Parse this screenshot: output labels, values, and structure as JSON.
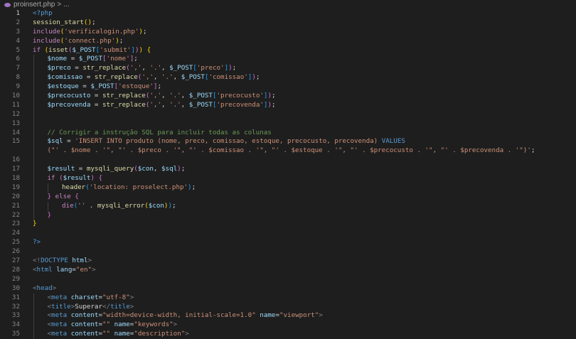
{
  "breadcrumb": {
    "file": "proinsert.php",
    "separator": ">",
    "more": "..."
  },
  "lines": [
    {
      "n": "1",
      "active": true,
      "indent": 0,
      "tokens": [
        [
          "tag",
          "<?php"
        ]
      ]
    },
    {
      "n": "2",
      "indent": 0,
      "tokens": [
        [
          "fn",
          "session_start"
        ],
        [
          "br1",
          "()"
        ],
        [
          "pl",
          ";"
        ]
      ]
    },
    {
      "n": "3",
      "indent": 0,
      "tokens": [
        [
          "kw",
          "include"
        ],
        [
          "br1",
          "("
        ],
        [
          "str",
          "'verificalogin.php'"
        ],
        [
          "br1",
          ")"
        ],
        [
          "pl",
          ";"
        ]
      ]
    },
    {
      "n": "4",
      "indent": 0,
      "tokens": [
        [
          "kw",
          "include"
        ],
        [
          "br1",
          "("
        ],
        [
          "str",
          "'connect.php'"
        ],
        [
          "br1",
          ")"
        ],
        [
          "pl",
          ";"
        ]
      ]
    },
    {
      "n": "5",
      "indent": 0,
      "tokens": [
        [
          "kw",
          "if"
        ],
        [
          "pl",
          " "
        ],
        [
          "br1",
          "("
        ],
        [
          "fn",
          "isset"
        ],
        [
          "br2",
          "("
        ],
        [
          "var",
          "$_POST"
        ],
        [
          "br3",
          "["
        ],
        [
          "str",
          "'submit'"
        ],
        [
          "br3",
          "]"
        ],
        [
          "br2",
          ")"
        ],
        [
          "br1",
          ")"
        ],
        [
          "pl",
          " "
        ],
        [
          "br1",
          "{"
        ]
      ]
    },
    {
      "n": "6",
      "indent": 1,
      "tokens": [
        [
          "var",
          "$nome"
        ],
        [
          "pl",
          " = "
        ],
        [
          "var",
          "$_POST"
        ],
        [
          "br2",
          "["
        ],
        [
          "str",
          "'nome'"
        ],
        [
          "br2",
          "]"
        ],
        [
          "pl",
          ";"
        ]
      ]
    },
    {
      "n": "7",
      "indent": 1,
      "tokens": [
        [
          "var",
          "$preco"
        ],
        [
          "pl",
          " = "
        ],
        [
          "fn",
          "str_replace"
        ],
        [
          "br2",
          "("
        ],
        [
          "str",
          "','"
        ],
        [
          "pl",
          ", "
        ],
        [
          "str",
          "'.'"
        ],
        [
          "pl",
          ", "
        ],
        [
          "var",
          "$_POST"
        ],
        [
          "br3",
          "["
        ],
        [
          "str",
          "'preco'"
        ],
        [
          "br3",
          "]"
        ],
        [
          "br2",
          ")"
        ],
        [
          "pl",
          ";"
        ]
      ]
    },
    {
      "n": "8",
      "indent": 1,
      "tokens": [
        [
          "var",
          "$comissao"
        ],
        [
          "pl",
          " = "
        ],
        [
          "fn",
          "str_replace"
        ],
        [
          "br2",
          "("
        ],
        [
          "str",
          "','"
        ],
        [
          "pl",
          ", "
        ],
        [
          "str",
          "'.'"
        ],
        [
          "pl",
          ", "
        ],
        [
          "var",
          "$_POST"
        ],
        [
          "br3",
          "["
        ],
        [
          "str",
          "'comissao'"
        ],
        [
          "br3",
          "]"
        ],
        [
          "br2",
          ")"
        ],
        [
          "pl",
          ";"
        ]
      ]
    },
    {
      "n": "9",
      "indent": 1,
      "tokens": [
        [
          "var",
          "$estoque"
        ],
        [
          "pl",
          " = "
        ],
        [
          "var",
          "$_POST"
        ],
        [
          "br2",
          "["
        ],
        [
          "str",
          "'estoque'"
        ],
        [
          "br2",
          "]"
        ],
        [
          "pl",
          ";"
        ]
      ]
    },
    {
      "n": "10",
      "indent": 1,
      "tokens": [
        [
          "var",
          "$precocusto"
        ],
        [
          "pl",
          " = "
        ],
        [
          "fn",
          "str_replace"
        ],
        [
          "br2",
          "("
        ],
        [
          "str",
          "','"
        ],
        [
          "pl",
          ", "
        ],
        [
          "str",
          "'.'"
        ],
        [
          "pl",
          ", "
        ],
        [
          "var",
          "$_POST"
        ],
        [
          "br3",
          "["
        ],
        [
          "str",
          "'precocusto'"
        ],
        [
          "br3",
          "]"
        ],
        [
          "br2",
          ")"
        ],
        [
          "pl",
          ";"
        ]
      ]
    },
    {
      "n": "11",
      "indent": 1,
      "tokens": [
        [
          "var",
          "$precovenda"
        ],
        [
          "pl",
          " = "
        ],
        [
          "fn",
          "str_replace"
        ],
        [
          "br2",
          "("
        ],
        [
          "str",
          "','"
        ],
        [
          "pl",
          ", "
        ],
        [
          "str",
          "'.'"
        ],
        [
          "pl",
          ", "
        ],
        [
          "var",
          "$_POST"
        ],
        [
          "br3",
          "["
        ],
        [
          "str",
          "'precovenda'"
        ],
        [
          "br3",
          "]"
        ],
        [
          "br2",
          ")"
        ],
        [
          "pl",
          ";"
        ]
      ]
    },
    {
      "n": "12",
      "indent": 1,
      "tokens": []
    },
    {
      "n": "13",
      "indent": 1,
      "tokens": []
    },
    {
      "n": "14",
      "indent": 1,
      "tokens": [
        [
          "com",
          "// Corrigir a instrução SQL para incluir todas as colunas"
        ]
      ]
    },
    {
      "n": "15",
      "indent": 1,
      "tokens": [
        [
          "var",
          "$sql"
        ],
        [
          "pl",
          " = "
        ],
        [
          "str",
          "'INSERT INTO produto (nome, preco, comissao, estoque, precocusto, precovenda) "
        ],
        [
          "tag",
          "VALUES"
        ]
      ]
    },
    {
      "n": "",
      "indent": 1,
      "tokens": [
        [
          "str",
          "(\"' . $nome . '\", \"' . $preco . '\", \"' . $comissao . '\", \"' . $estoque . '\", \"' . $precocusto . '\", \"' . $precovenda . '\")'"
        ],
        [
          "pl",
          ";"
        ]
      ]
    },
    {
      "n": "16",
      "indent": 1,
      "tokens": []
    },
    {
      "n": "17",
      "indent": 1,
      "tokens": [
        [
          "var",
          "$result"
        ],
        [
          "pl",
          " = "
        ],
        [
          "fn",
          "mysqli_query"
        ],
        [
          "br2",
          "("
        ],
        [
          "var",
          "$con"
        ],
        [
          "pl",
          ", "
        ],
        [
          "var",
          "$sql"
        ],
        [
          "br2",
          ")"
        ],
        [
          "pl",
          ";"
        ]
      ]
    },
    {
      "n": "18",
      "indent": 1,
      "tokens": [
        [
          "kw",
          "if"
        ],
        [
          "pl",
          " "
        ],
        [
          "br2",
          "("
        ],
        [
          "var",
          "$result"
        ],
        [
          "br2",
          ")"
        ],
        [
          "pl",
          " "
        ],
        [
          "br2",
          "{"
        ]
      ]
    },
    {
      "n": "19",
      "indent": 2,
      "tokens": [
        [
          "fn",
          "header"
        ],
        [
          "br3",
          "("
        ],
        [
          "str",
          "'location: proselect.php'"
        ],
        [
          "br3",
          ")"
        ],
        [
          "pl",
          ";"
        ]
      ]
    },
    {
      "n": "20",
      "indent": 1,
      "tokens": [
        [
          "br2",
          "}"
        ],
        [
          "pl",
          " "
        ],
        [
          "kw",
          "else"
        ],
        [
          "pl",
          " "
        ],
        [
          "br2",
          "{"
        ]
      ]
    },
    {
      "n": "21",
      "indent": 2,
      "tokens": [
        [
          "kw",
          "die"
        ],
        [
          "br3",
          "("
        ],
        [
          "str",
          "''"
        ],
        [
          "pl",
          " . "
        ],
        [
          "fn",
          "mysqli_error"
        ],
        [
          "br1",
          "("
        ],
        [
          "var",
          "$con"
        ],
        [
          "br1",
          ")"
        ],
        [
          "br3",
          ")"
        ],
        [
          "pl",
          ";"
        ]
      ]
    },
    {
      "n": "22",
      "indent": 1,
      "tokens": [
        [
          "br2",
          "}"
        ]
      ]
    },
    {
      "n": "23",
      "indent": 0,
      "tokens": [
        [
          "br1",
          "}"
        ]
      ]
    },
    {
      "n": "24",
      "indent": 0,
      "tokens": []
    },
    {
      "n": "25",
      "indent": 0,
      "tokens": [
        [
          "tag",
          "?>"
        ]
      ]
    },
    {
      "n": "26",
      "indent": 0,
      "tokens": []
    },
    {
      "n": "27",
      "indent": 0,
      "tokens": [
        [
          "gray",
          "<!"
        ],
        [
          "tag",
          "DOCTYPE"
        ],
        [
          "pl",
          " "
        ],
        [
          "var",
          "html"
        ],
        [
          "gray",
          ">"
        ]
      ]
    },
    {
      "n": "28",
      "indent": 0,
      "tokens": [
        [
          "gray",
          "<"
        ],
        [
          "tag",
          "html"
        ],
        [
          "pl",
          " "
        ],
        [
          "var",
          "lang"
        ],
        [
          "pl",
          "="
        ],
        [
          "str",
          "\"en\""
        ],
        [
          "gray",
          ">"
        ]
      ]
    },
    {
      "n": "29",
      "indent": 0,
      "tokens": []
    },
    {
      "n": "30",
      "indent": 0,
      "tokens": [
        [
          "gray",
          "<"
        ],
        [
          "tag",
          "head"
        ],
        [
          "gray",
          ">"
        ]
      ]
    },
    {
      "n": "31",
      "indent": 1,
      "tokens": [
        [
          "gray",
          "<"
        ],
        [
          "tag",
          "meta"
        ],
        [
          "pl",
          " "
        ],
        [
          "var",
          "charset"
        ],
        [
          "pl",
          "="
        ],
        [
          "str",
          "\"utf-8\""
        ],
        [
          "gray",
          ">"
        ]
      ]
    },
    {
      "n": "32",
      "indent": 1,
      "tokens": [
        [
          "gray",
          "<"
        ],
        [
          "tag",
          "title"
        ],
        [
          "gray",
          ">"
        ],
        [
          "pl",
          "Superar"
        ],
        [
          "gray",
          "</"
        ],
        [
          "tag",
          "title"
        ],
        [
          "gray",
          ">"
        ]
      ]
    },
    {
      "n": "33",
      "indent": 1,
      "tokens": [
        [
          "gray",
          "<"
        ],
        [
          "tag",
          "meta"
        ],
        [
          "pl",
          " "
        ],
        [
          "var",
          "content"
        ],
        [
          "pl",
          "="
        ],
        [
          "str",
          "\"width=device-width, initial-scale=1.0\""
        ],
        [
          "pl",
          " "
        ],
        [
          "var",
          "name"
        ],
        [
          "pl",
          "="
        ],
        [
          "str",
          "\"viewport\""
        ],
        [
          "gray",
          ">"
        ]
      ]
    },
    {
      "n": "34",
      "indent": 1,
      "tokens": [
        [
          "gray",
          "<"
        ],
        [
          "tag",
          "meta"
        ],
        [
          "pl",
          " "
        ],
        [
          "var",
          "content"
        ],
        [
          "pl",
          "="
        ],
        [
          "str",
          "\"\""
        ],
        [
          "pl",
          " "
        ],
        [
          "var",
          "name"
        ],
        [
          "pl",
          "="
        ],
        [
          "str",
          "\"keywords\""
        ],
        [
          "gray",
          ">"
        ]
      ]
    },
    {
      "n": "35",
      "indent": 1,
      "tokens": [
        [
          "gray",
          "<"
        ],
        [
          "tag",
          "meta"
        ],
        [
          "pl",
          " "
        ],
        [
          "var",
          "content"
        ],
        [
          "pl",
          "="
        ],
        [
          "str",
          "\"\""
        ],
        [
          "pl",
          " "
        ],
        [
          "var",
          "name"
        ],
        [
          "pl",
          "="
        ],
        [
          "str",
          "\"description\""
        ],
        [
          "gray",
          ">"
        ]
      ]
    }
  ]
}
